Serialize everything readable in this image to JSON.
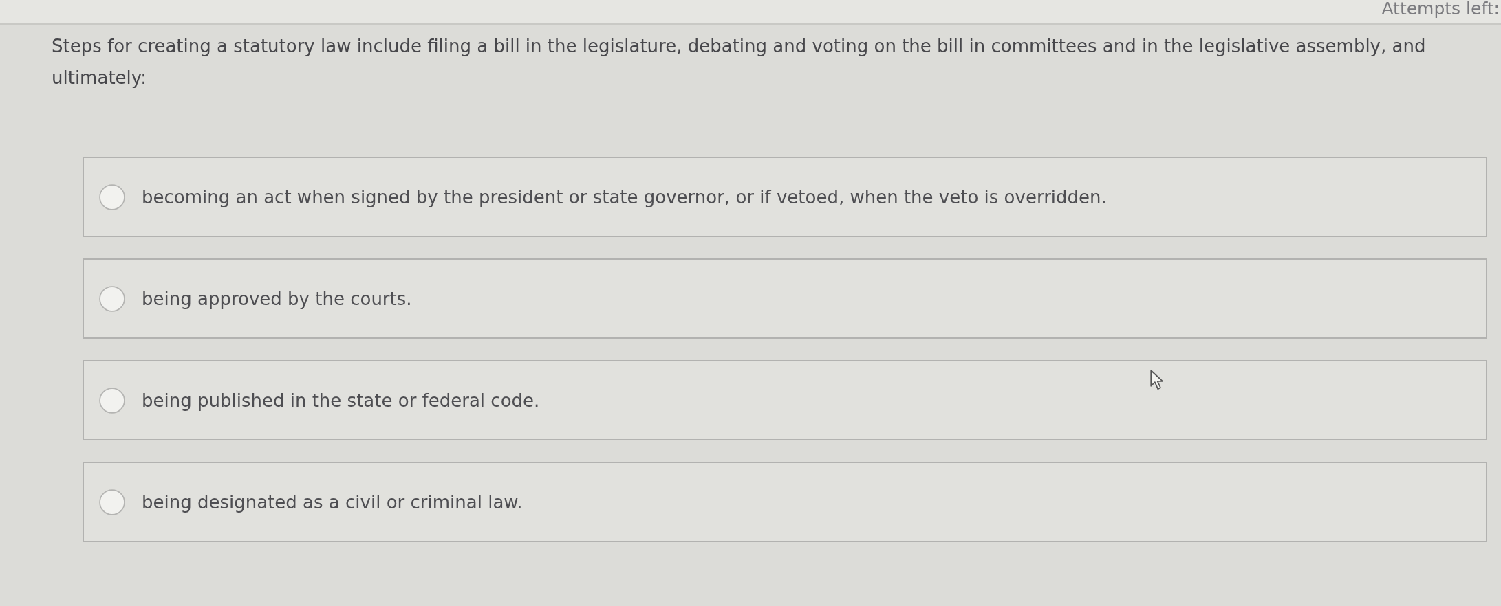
{
  "header": {
    "attempts_label": "Attempts left:"
  },
  "question": {
    "text": "Steps for creating a statutory law include filing a bill in the legislature, debating and voting on the bill in committees and in the legislative assembly, and ultimately:"
  },
  "options": [
    {
      "text": "becoming an act when signed by the president or state governor, or if vetoed, when the veto is overridden.",
      "selected": false
    },
    {
      "text": "being approved by the courts.",
      "selected": false
    },
    {
      "text": "being published in the state or federal code.",
      "selected": false
    },
    {
      "text": "being designated as a civil or criminal law.",
      "selected": false
    }
  ]
}
